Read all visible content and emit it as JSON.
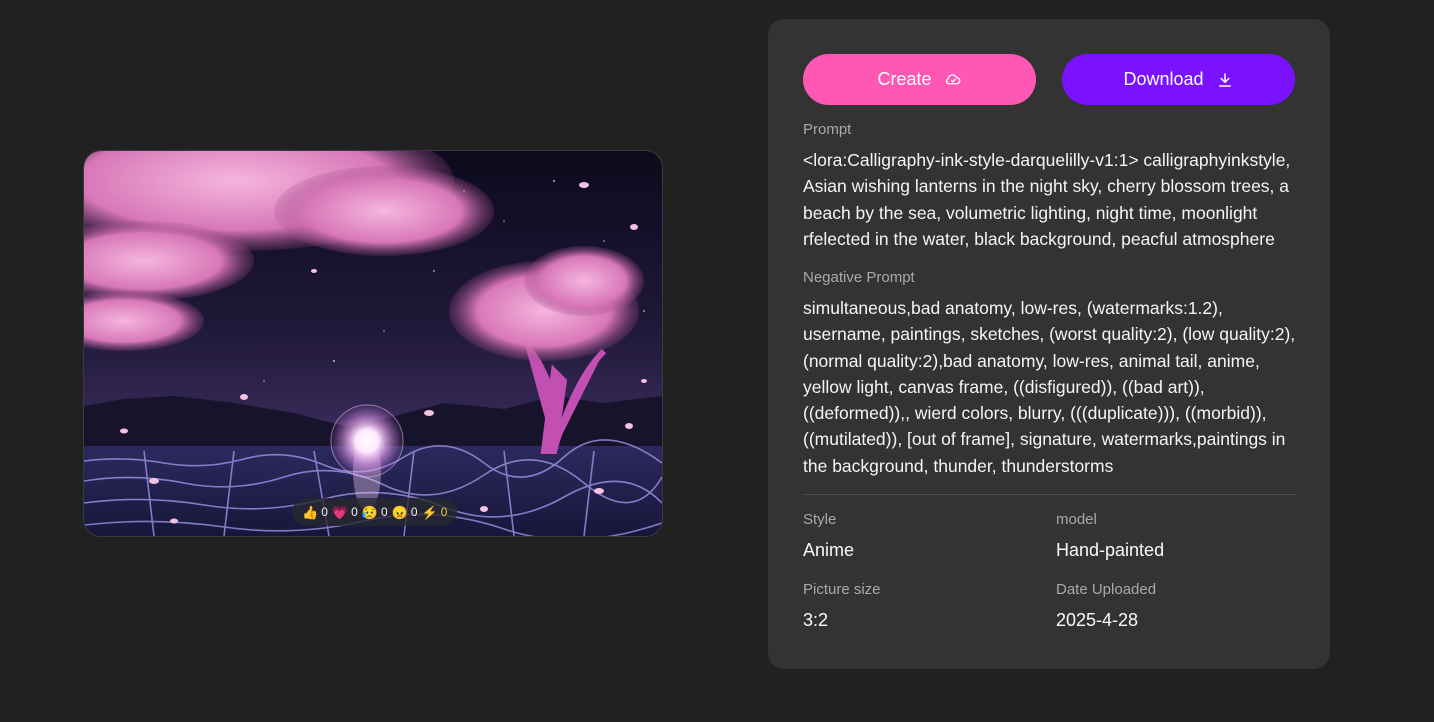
{
  "artwork": {
    "reactions": [
      {
        "icon": "thumbs-up-icon",
        "glyph": "👍",
        "count": "0"
      },
      {
        "icon": "heart-icon",
        "glyph": "💗",
        "count": "0"
      },
      {
        "icon": "sad-face-icon",
        "glyph": "😥",
        "count": "0"
      },
      {
        "icon": "angry-face-icon",
        "glyph": "😠",
        "count": "0"
      },
      {
        "icon": "lightning-icon",
        "glyph": "⚡",
        "count": "0"
      }
    ]
  },
  "actions": {
    "create_label": "Create",
    "download_label": "Download"
  },
  "details": {
    "prompt_label": "Prompt",
    "prompt_text": "<lora:Calligraphy-ink-style-darquelilly-v1:1> calligraphyinkstyle, Asian wishing lanterns in the night sky, cherry blossom trees, a beach by the sea, volumetric lighting, night time, moonlight rfelected in the water, black background, peacful atmosphere",
    "negative_label": "Negative Prompt",
    "negative_text": "simultaneous,bad anatomy, low-res, (watermarks:1.2), username, paintings, sketches, (worst quality:2), (low quality:2), (normal quality:2),bad anatomy, low-res, animal tail, anime, yellow light, canvas frame, ((disfigured)), ((bad art)), ((deformed)),, wierd colors, blurry, (((duplicate))), ((morbid)), ((mutilated)), [out of frame], signature, watermarks,paintings in the background, thunder, thunderstorms",
    "style_label": "Style",
    "style_value": "Anime",
    "model_label": "model",
    "model_value": "Hand-painted",
    "size_label": "Picture size",
    "size_value": "3:2",
    "date_label": "Date Uploaded",
    "date_value": "2025-4-28"
  },
  "colors": {
    "create_button": "#ff57b4",
    "download_button": "#7b12ff",
    "panel_bg": "#333333",
    "page_bg": "#212121"
  }
}
